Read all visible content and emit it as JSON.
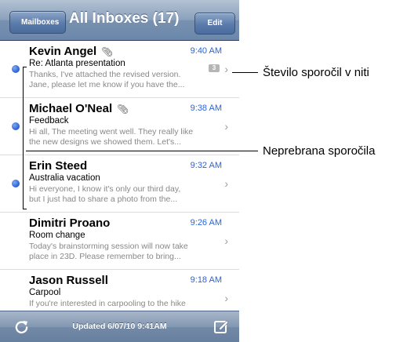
{
  "navbar": {
    "back_label": "Mailboxes",
    "title": "All Inboxes (17)",
    "edit_label": "Edit"
  },
  "messages": [
    {
      "sender": "Kevin Angel",
      "attachment": true,
      "time": "9:40 AM",
      "subject": "Re: Atlanta presentation",
      "preview": [
        "Thanks, I've attached the revised version.",
        "Jane, please let me know if you have the..."
      ],
      "thread_count": "3",
      "unread": true
    },
    {
      "sender": "Michael O'Neal",
      "attachment": true,
      "time": "9:38 AM",
      "subject": "Feedback",
      "preview": [
        "Hi all, The meeting went well. They really like",
        "the new designs we showed them. Let's..."
      ],
      "unread": true
    },
    {
      "sender": "Erin Steed",
      "attachment": false,
      "time": "9:32 AM",
      "subject": "Australia vacation",
      "preview": [
        "Hi everyone, I know it's only our third day,",
        "but I just had to share a photo from the..."
      ],
      "unread": true
    },
    {
      "sender": "Dimitri Proano",
      "attachment": false,
      "time": "9:26 AM",
      "subject": "Room change",
      "preview": [
        "Today's brainstorming session will now take",
        "place in 23D. Please remember to bring..."
      ],
      "unread": false
    },
    {
      "sender": "Jason Russell",
      "attachment": false,
      "time": "9:18 AM",
      "subject": "Carpool",
      "preview": [
        "If you're interested in carpooling to the hike",
        ""
      ],
      "unread": false
    }
  ],
  "toolbar": {
    "updated_text": "Updated 6/07/10 9:41AM"
  },
  "callouts": {
    "thread_count": "Število sporočil v niti",
    "unread": "Neprebrana sporočila"
  },
  "icons": {
    "refresh": "refresh-icon",
    "compose": "compose-icon",
    "attachment": "paperclip-icon",
    "chevron": "chevron-right-icon"
  },
  "colors": {
    "time": "#2a64d8",
    "unread_dot": "#2f63d6",
    "navbar": "#7891b0"
  }
}
